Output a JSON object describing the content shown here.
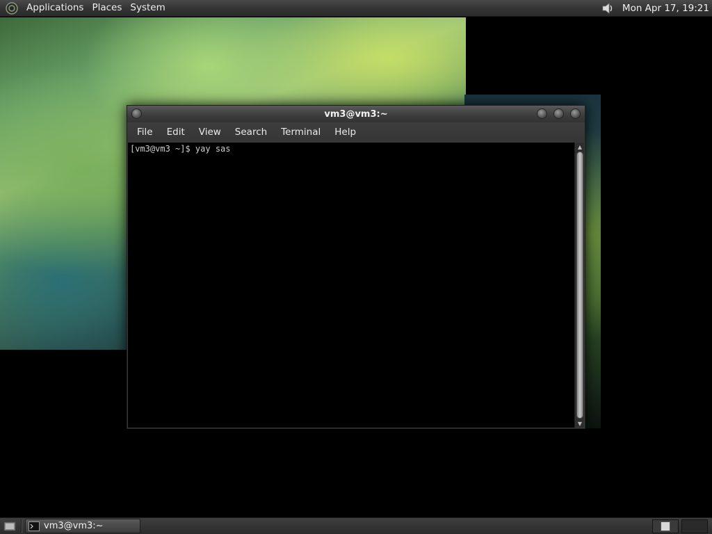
{
  "top_panel": {
    "menus": [
      "Applications",
      "Places",
      "System"
    ],
    "clock": "Mon Apr 17, 19:21",
    "icons": {
      "logo": "gnome-foot-icon",
      "volume": "speaker-icon"
    }
  },
  "terminal": {
    "title": "vm3@vm3:~",
    "menus": [
      "File",
      "Edit",
      "View",
      "Search",
      "Terminal",
      "Help"
    ],
    "lines": [
      "[vm3@vm3 ~]$ yay sas"
    ]
  },
  "bottom_panel": {
    "task_label": "vm3@vm3:~",
    "icons": {
      "show_desktop": "show-desktop-icon",
      "task": "terminal-icon"
    }
  },
  "colors": {
    "panel": "#333333",
    "terminal_bg": "#000000",
    "terminal_fg": "#cfcfcf"
  }
}
